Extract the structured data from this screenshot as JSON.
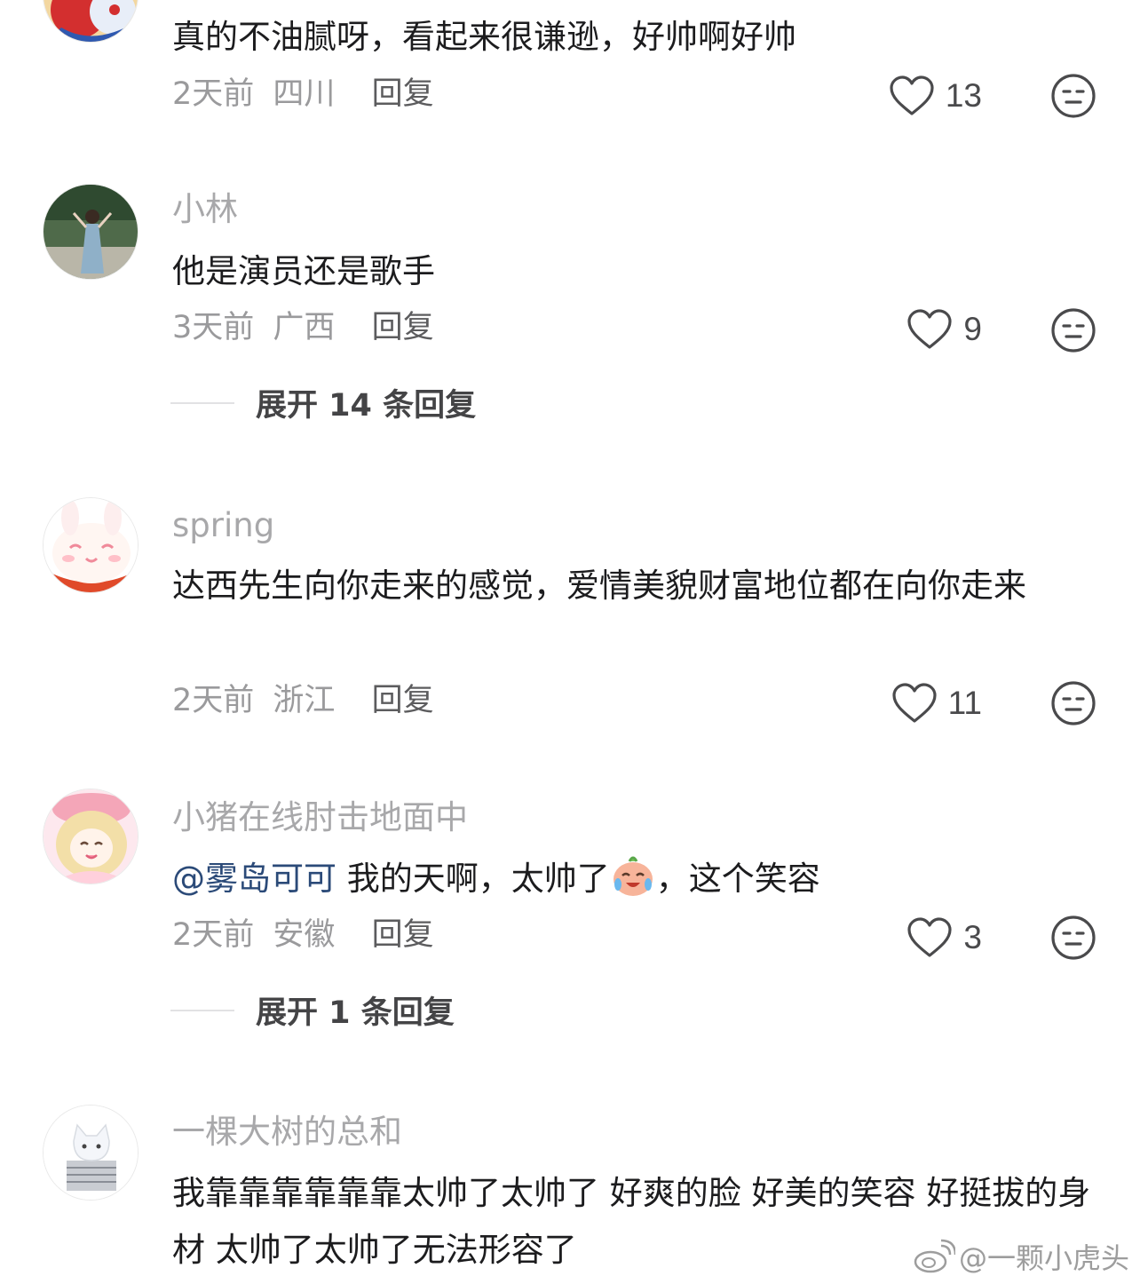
{
  "comments": [
    {
      "avatar": "spiderman-avatar",
      "username": "",
      "text": "真的不油腻呀，看起来很谦逊，好帅啊好帅",
      "time": "2天前",
      "location": "四川",
      "reply_label": "回复",
      "likes": "13"
    },
    {
      "avatar": "girl-photo-avatar",
      "username": "小林",
      "text": "他是演员还是歌手",
      "time": "3天前",
      "location": "广西",
      "reply_label": "回复",
      "likes": "9",
      "expand_label": "展开 14 条回复"
    },
    {
      "avatar": "bunny-avatar",
      "username": "spring",
      "text": "达西先生向你走来的感觉，爱情美貌财富地位都在向你走来",
      "time": "2天前",
      "location": "浙江",
      "reply_label": "回复",
      "likes": "11"
    },
    {
      "avatar": "anime-girl-avatar",
      "username": "小猪在线肘击地面中",
      "mention": "@雾岛可可",
      "text_part1": " 我的天啊，太帅了",
      "emoji": "laughing-crying-emoji",
      "text_part2": "，这个笑容",
      "time": "2天前",
      "location": "安徽",
      "reply_label": "回复",
      "likes": "3",
      "expand_label": "展开 1 条回复"
    },
    {
      "avatar": "white-cat-avatar",
      "username": "一棵大树的总和",
      "text": "我靠靠靠靠靠靠太帅了太帅了 好爽的脸 好美的笑容 好挺拔的身材 太帅了太帅了无法形容了"
    }
  ],
  "watermark": "@一颗小虎头",
  "colors": {
    "text": "#1c1c1e",
    "username": "#a8a8aa",
    "meta": "#9a9a9c",
    "mention": "#2b4a78",
    "icon": "#4a4a4c"
  }
}
